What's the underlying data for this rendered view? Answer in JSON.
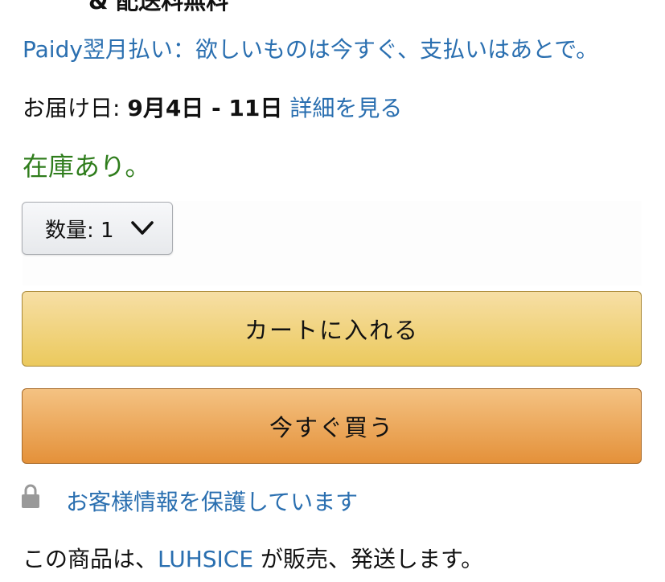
{
  "top_cut_text": "& 配送料無料",
  "paidy_link": "Paidy翌月払い：欲しいものは今すぐ、支払いはあとで。",
  "delivery": {
    "label": "お届け日: ",
    "date": "9月4日 - 11日",
    "details_link": "詳細を見る"
  },
  "stock_status": "在庫あり。",
  "quantity": {
    "label": "数量: 1",
    "icon": "chevron-down-icon"
  },
  "buttons": {
    "add_to_cart": "カートに入れる",
    "buy_now": "今すぐ買う"
  },
  "secure": {
    "icon": "lock-icon",
    "text": "お客様情報を保護しています"
  },
  "seller": {
    "prefix": "この商品は、",
    "name": "LUHSICE",
    "suffix": " が販売、発送します。"
  },
  "colors": {
    "link": "#2a6fb0",
    "in_stock": "#2f7d1c",
    "cart_button": "#f0d070",
    "buy_button": "#eba45a"
  }
}
